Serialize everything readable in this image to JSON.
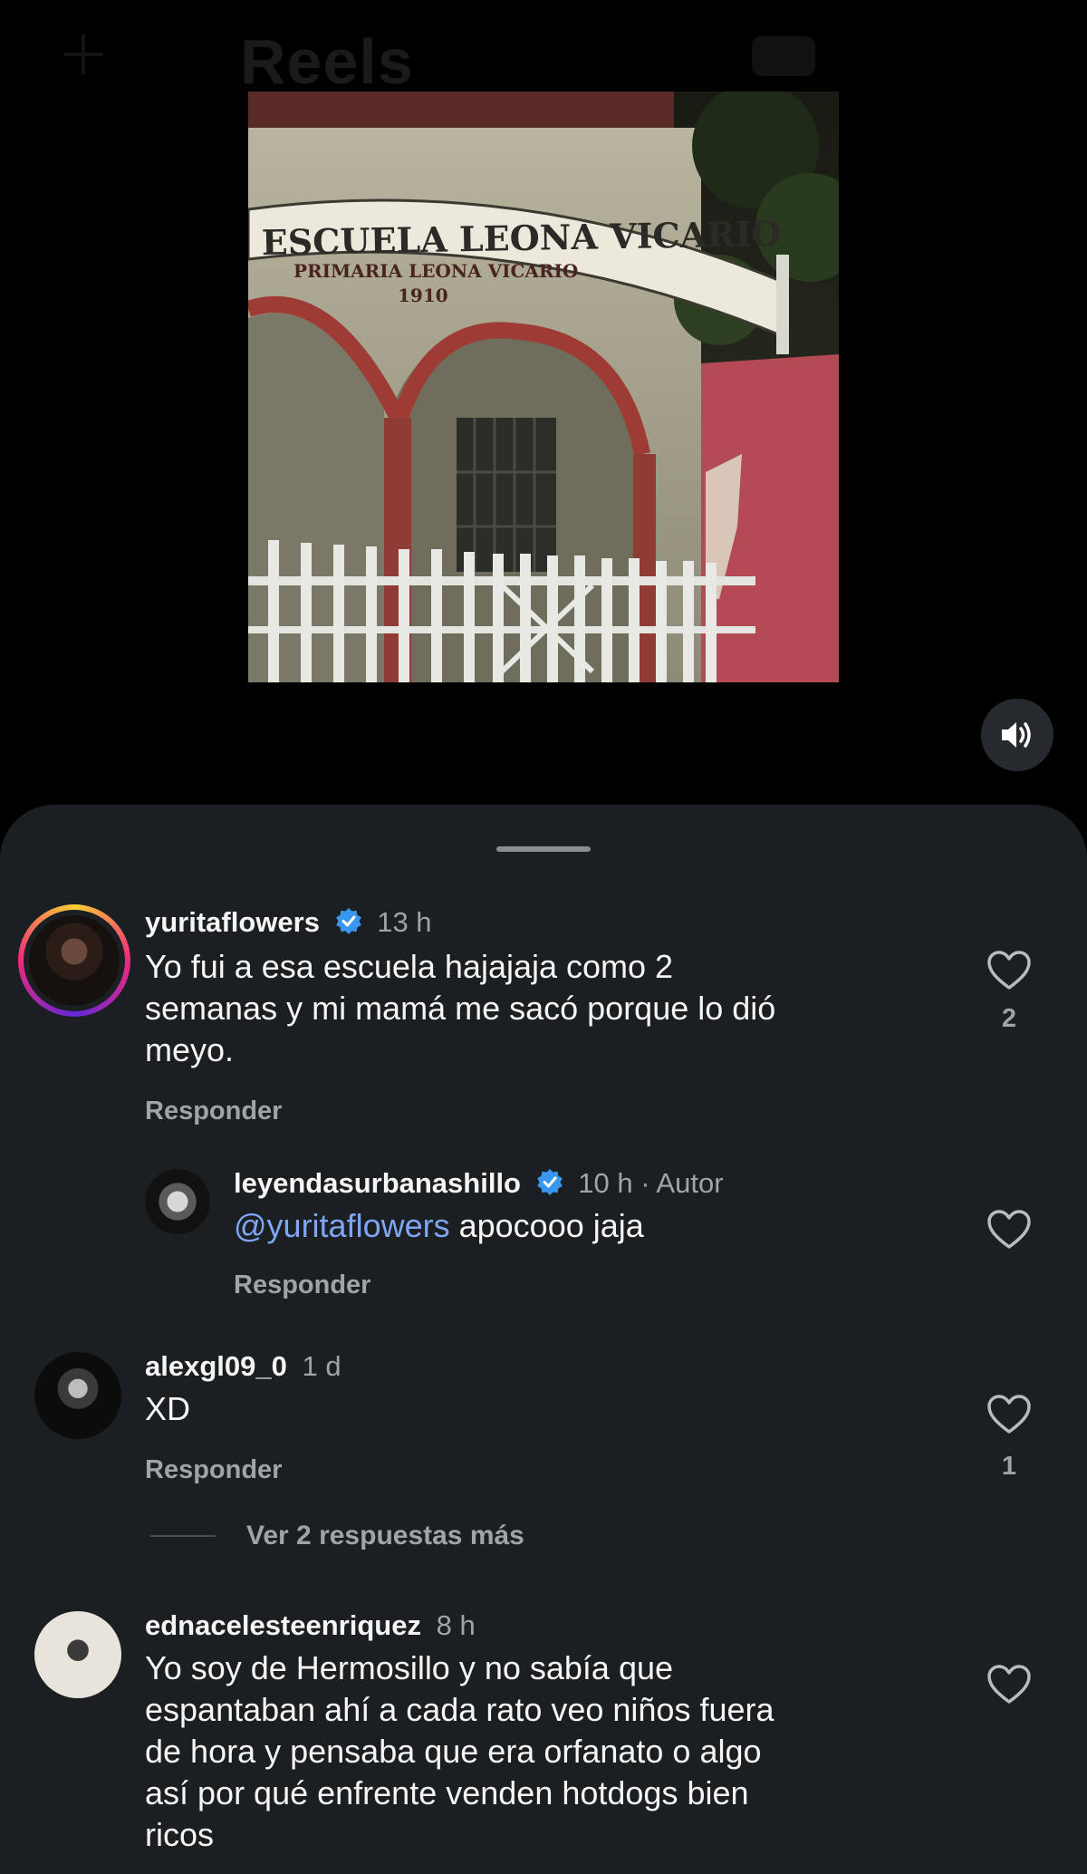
{
  "background_header": {
    "title": "Reels"
  },
  "video": {
    "sign_main": "ESCUELA LEONA VICARIO",
    "sign_sub": "PRIMARIA LEONA VICARIO",
    "sign_year": "1910"
  },
  "comments": [
    {
      "username": "yuritaflowers",
      "verified": true,
      "time": "13 h",
      "lines": [
        "Yo fui a esa escuela hajajaja como 2",
        "semanas y mi mamá me sacó porque lo dió",
        "meyo."
      ],
      "reply_label": "Responder",
      "likes": "2"
    },
    {
      "username": "leyendasurbanashillo",
      "verified": true,
      "time": "10 h · Autor",
      "mention": "@yuritaflowers",
      "text": " apocooo jaja",
      "reply_label": "Responder"
    },
    {
      "username": "alexgl09_0",
      "verified": false,
      "time": "1 d",
      "text": "XD",
      "reply_label": "Responder",
      "likes": "1",
      "view_more": "Ver 2 respuestas más"
    },
    {
      "username": "ednacelesteenriquez",
      "verified": false,
      "time": "8 h",
      "lines": [
        "Yo soy de Hermosillo y no sabía que",
        "espantaban ahí a cada rato veo niños fuera",
        "de hora y pensaba que era orfanato o algo",
        "así por qué enfrente venden hotdogs bien",
        "ricos"
      ]
    }
  ],
  "colors": {
    "sheet_bg": "#1b1f22",
    "mention": "#7fa6f5",
    "verified": "#3897f0",
    "muted_text": "#a0a4a8"
  },
  "icons": [
    "plus-icon",
    "speaker-icon",
    "verified-badge-icon",
    "heart-icon"
  ]
}
